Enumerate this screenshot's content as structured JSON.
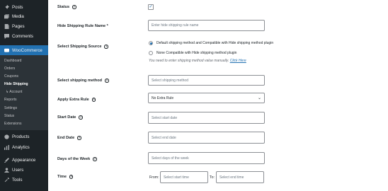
{
  "sidebar": {
    "items": [
      {
        "label": "Posts",
        "icon": "pin-icon"
      },
      {
        "label": "Media",
        "icon": "media-icon"
      },
      {
        "label": "Pages",
        "icon": "pages-icon"
      },
      {
        "label": "Comments",
        "icon": "comments-icon"
      },
      {
        "label": "WooCommerce",
        "icon": "woocommerce-icon"
      },
      {
        "label": "Products",
        "icon": "products-icon"
      },
      {
        "label": "Analytics",
        "icon": "analytics-icon"
      },
      {
        "label": "Appearance",
        "icon": "appearance-icon"
      },
      {
        "label": "Users",
        "icon": "users-icon"
      },
      {
        "label": "Tools",
        "icon": "tools-icon"
      }
    ],
    "submenu": [
      "Dashboard",
      "Orders",
      "Coupons",
      "Hide Shipping",
      "↳ Account",
      "Reports",
      "Settings",
      "Status",
      "Extensions"
    ],
    "colors": {
      "bg": "#1d2327",
      "active": "#2271b1",
      "submenu_bg": "#2c3338"
    }
  },
  "form": {
    "status": {
      "label": "Status",
      "checked": true
    },
    "rule_name": {
      "label": "Hide Shipping Rule Name *",
      "placeholder": "Enter hide shipping rule name"
    },
    "source": {
      "label": "Select Shipping Source",
      "option1": "Default shipping method and Compatible with Hide shipping method plugin",
      "option2": "None Compatible with Hide shipping method plugin",
      "hint": "You need to enter shipping method value manually.",
      "hint_link": "Click Here"
    },
    "shipping_method": {
      "label": "Select shipping method",
      "placeholder": "Select shipping method"
    },
    "extra_rule": {
      "label": "Apply Extra Rule",
      "value": "No Extra Rule"
    },
    "start_date": {
      "label": "Start Date",
      "placeholder": "Select start date"
    },
    "end_date": {
      "label": "End Date",
      "placeholder": "Select end date"
    },
    "days": {
      "label": "Days of the Week",
      "placeholder": "Select days of the week"
    },
    "time": {
      "label": "Time",
      "from_label": "From:",
      "from_placeholder": "Select start time",
      "to_label": "To:",
      "to_placeholder": "Select end time"
    }
  }
}
